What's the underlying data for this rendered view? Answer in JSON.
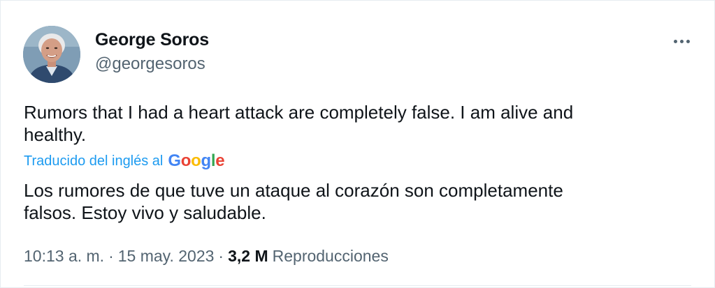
{
  "author": {
    "name": "George Soros",
    "handle": "@georgesoros"
  },
  "menu": {
    "icon": "more-horizontal-icon"
  },
  "tweet": {
    "text_lines": [
      "Rumors that I had a heart attack are completely false. I am alive and",
      "healthy."
    ],
    "translated_by_label": "Traducido del inglés al",
    "google_logo_letters": [
      "G",
      "o",
      "o",
      "g",
      "l",
      "e"
    ],
    "translation_lines": [
      "Los rumores de que tuve un ataque al corazón son completamente",
      "falsos. Estoy vivo y saludable."
    ]
  },
  "meta": {
    "time": "10:13 a. m.",
    "separator": "·",
    "date": "15 may. 2023",
    "views_count": "3,2 M",
    "views_label": "Reproducciones"
  },
  "colors": {
    "text": "#0f1419",
    "secondary": "#536471",
    "link_blue": "#1d9bf0",
    "google_blue": "#4285f4",
    "google_red": "#ea4335",
    "google_yellow": "#fbbc05",
    "google_green": "#34a853"
  }
}
